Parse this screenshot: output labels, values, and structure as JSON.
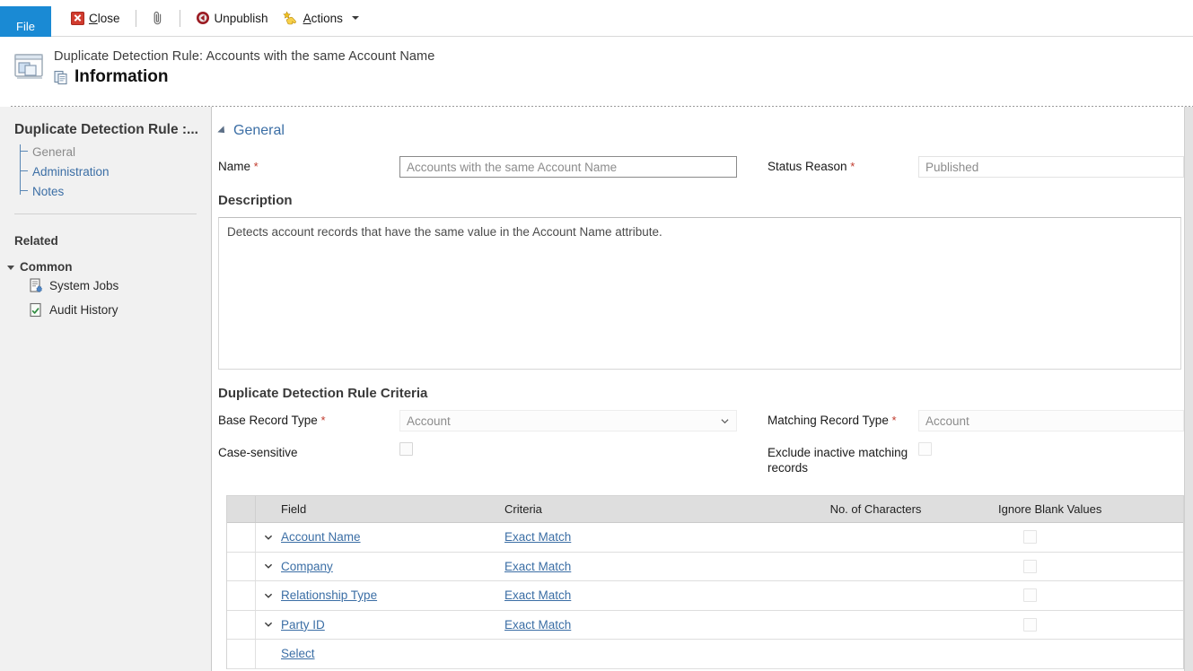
{
  "ribbon": {
    "file_tab": "File",
    "buttons": [
      {
        "label": "Close",
        "icon": "close-icon",
        "underline_index": 1
      },
      {
        "label": "",
        "icon": "paperclip-icon"
      },
      {
        "label": "Unpublish",
        "icon": "unpublish-icon"
      },
      {
        "label": "Actions",
        "icon": "actions-icon",
        "has_caret": true
      }
    ]
  },
  "titlebar": {
    "record_icon": "record-window-icon",
    "subtitle": "Duplicate Detection Rule: Accounts with the same Account Name",
    "info_icon": "information-page-icon",
    "title": "Information"
  },
  "sidebar": {
    "heading": "Duplicate Detection Rule :...",
    "items": [
      {
        "label": "General",
        "current": true
      },
      {
        "label": "Administration",
        "current": false
      },
      {
        "label": "Notes",
        "current": false
      }
    ],
    "related_label": "Related",
    "group_label": "Common",
    "links": [
      {
        "label": "System Jobs",
        "icon": "system-jobs-icon"
      },
      {
        "label": "Audit History",
        "icon": "audit-history-icon"
      }
    ]
  },
  "form": {
    "section_title": "General",
    "name_label": "Name",
    "name_value": "Accounts with the same Account Name",
    "status_reason_label": "Status Reason",
    "status_reason_value": "Published",
    "description_label": "Description",
    "description_value": "Detects account records that have the same value in the Account Name attribute.",
    "criteria_heading": "Duplicate Detection Rule Criteria",
    "base_record_type_label": "Base Record Type",
    "base_record_type_value": "Account",
    "matching_record_type_label": "Matching Record Type",
    "matching_record_type_value": "Account",
    "case_sensitive_label": "Case-sensitive",
    "case_sensitive_checked": false,
    "exclude_inactive_label": "Exclude inactive matching records",
    "exclude_inactive_checked": false,
    "required_marker": "*"
  },
  "grid": {
    "columns": [
      "Field",
      "Criteria",
      "No. of Characters",
      "Ignore Blank Values"
    ],
    "rows": [
      {
        "field": "Account Name",
        "criteria": "Exact Match",
        "chars": "",
        "ignore_blank": false
      },
      {
        "field": "Company",
        "criteria": "Exact Match",
        "chars": "",
        "ignore_blank": false
      },
      {
        "field": "Relationship Type",
        "criteria": "Exact Match",
        "chars": "",
        "ignore_blank": false
      },
      {
        "field": "Party ID",
        "criteria": "Exact Match",
        "chars": "",
        "ignore_blank": false
      }
    ],
    "add_row_label": "Select"
  },
  "colors": {
    "accent_blue": "#1a8ad4",
    "link_blue": "#3b6ea5",
    "required_red": "#c0392b",
    "sidebar_bg": "#f1f1f1",
    "grid_header_bg": "#dedede"
  }
}
